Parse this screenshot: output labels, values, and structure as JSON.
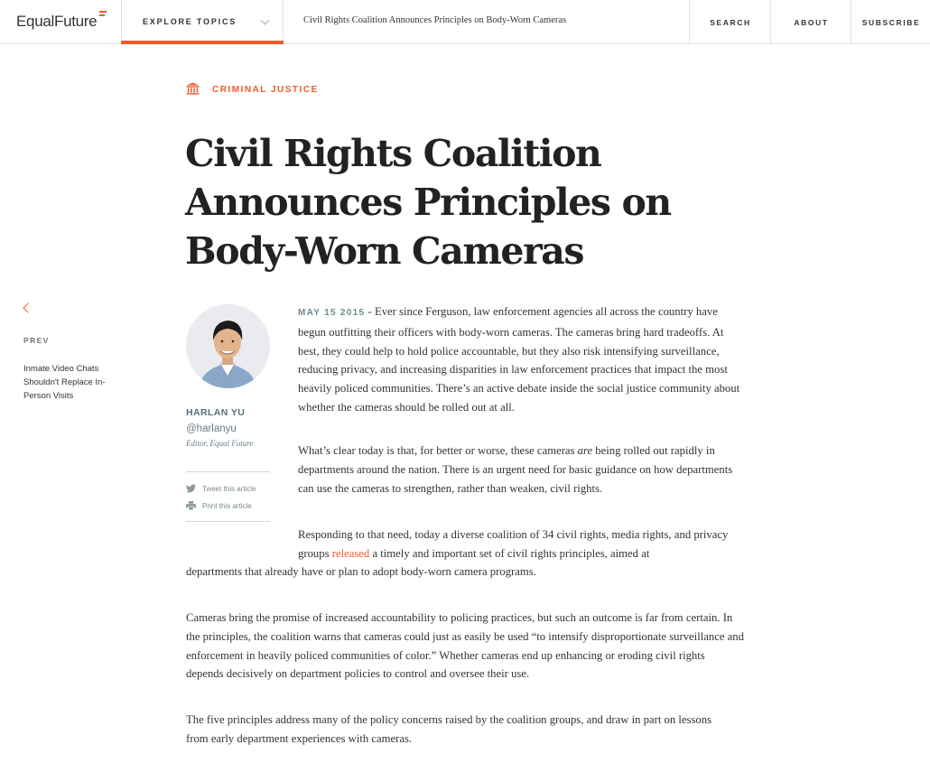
{
  "header": {
    "logo": "EqualFuture",
    "explore_label": "EXPLORE TOPICS",
    "headline": "Civil Rights Coalition Announces Principles on Body-Worn Cameras",
    "nav": [
      "SEARCH",
      "ABOUT",
      "SUBSCRIBE"
    ]
  },
  "article": {
    "category": "CRIMINAL JUSTICE",
    "title": "Civil Rights Coalition Announces Principles on Body-Worn Cameras",
    "date": "MAY 15 2015",
    "separator": " - ",
    "p1": "Ever since Ferguson, law enforcement agencies all across the country have begun outfitting their officers with body-worn cameras. The cameras bring hard tradeoffs. At best, they could help to hold police accountable, but they also risk intensifying surveillance, reducing privacy, and increasing disparities in law enforcement practices that impact the most heavily policed communities. There’s an active debate inside the social justice community about whether the cameras should be rolled out at all.",
    "p2_a": "What’s clear today is that, for better or worse, these cameras ",
    "p2_em": "are",
    "p2_b": " being rolled out rapidly in departments around the nation. There is an urgent need for basic guidance on how departments can use the cameras to strengthen, rather than weaken, civil rights.",
    "p3_a": "Responding to that need, today a diverse coalition of 34 civil rights, media rights, and privacy groups ",
    "p3_link": "released",
    "p3_b": " a timely and important set of civil rights principles, aimed at",
    "p3_c": "departments that already have or plan to adopt body-worn camera programs.",
    "p4": "Cameras bring the promise of increased accountability to policing practices, but such an outcome is far from certain. In the principles, the coalition warns that cameras could just as easily be used “to intensify disproportionate surveillance and enforcement in heavily policed communities of color.” Whether cameras end up enhancing or eroding civil rights depends decisively on department policies to control and oversee their use.",
    "p5": "The five principles address many of the policy concerns raised by the coalition groups, and draw in part on lessons from early department experiences with cameras."
  },
  "prev": {
    "label": "PREV",
    "title": "Inmate Video Chats Shouldn't Replace In-Person Visits"
  },
  "author": {
    "name": "HARLAN YU",
    "handle": "@harlanyu",
    "role": "Editor, Equal Future",
    "tweet": "Tweet this article",
    "print": "Print this article"
  },
  "colors": {
    "accent": "#f05a28",
    "author": "#546e7a"
  }
}
